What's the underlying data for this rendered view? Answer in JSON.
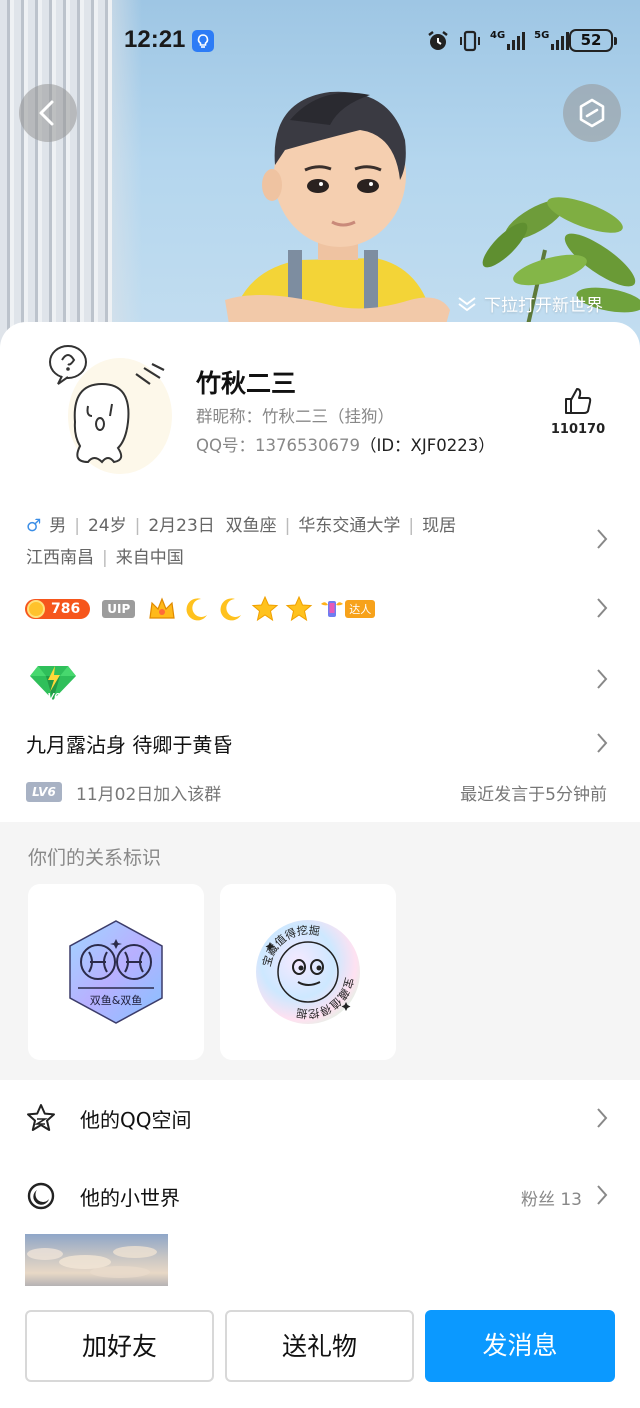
{
  "status_bar": {
    "time": "12:21",
    "network_4g": "4G",
    "network_5g": "5G",
    "battery": "52"
  },
  "hero": {
    "pull_hint": "下拉打开新世界"
  },
  "profile": {
    "name": "竹秋二三",
    "group_nickname": "群昵称：竹秋二三（挂狗）",
    "qq_label": "QQ号：",
    "qq_number": "1376530679",
    "qq_id": "（ID：XJF0223）",
    "likes": "110170"
  },
  "info": {
    "gender": "♂",
    "items": [
      "男",
      "24岁",
      "2月23日",
      "双鱼座",
      "华东交通大学",
      "现居"
    ],
    "line2": [
      "江西南昌",
      "来自中国"
    ]
  },
  "badges": {
    "coin_value": "786",
    "uip": "UIP",
    "daren": "达人"
  },
  "level": {
    "gem_label": "LV6"
  },
  "motto": "九月露沾身 待卿于黄昏",
  "group": {
    "lv_tag": "LV6",
    "joined": "11月02日加入该群",
    "last_speak": "最近发言于5分钟前"
  },
  "relation": {
    "title": "你们的关系标识",
    "cards": [
      {
        "caption": "双鱼&双鱼"
      },
      {
        "ring_text": "宝藏值得挖掘"
      }
    ]
  },
  "list": [
    {
      "label": "他的QQ空间",
      "icon": "star-icon"
    },
    {
      "label": "他的小世界",
      "icon": "moon-icon",
      "fans": "粉丝 13"
    }
  ],
  "actions": {
    "add_friend": "加好友",
    "send_gift": "送礼物",
    "send_message": "发消息"
  },
  "colors": {
    "primary": "#0b99ff",
    "coin": "#f6561c",
    "gender": "#3b8ee6"
  }
}
